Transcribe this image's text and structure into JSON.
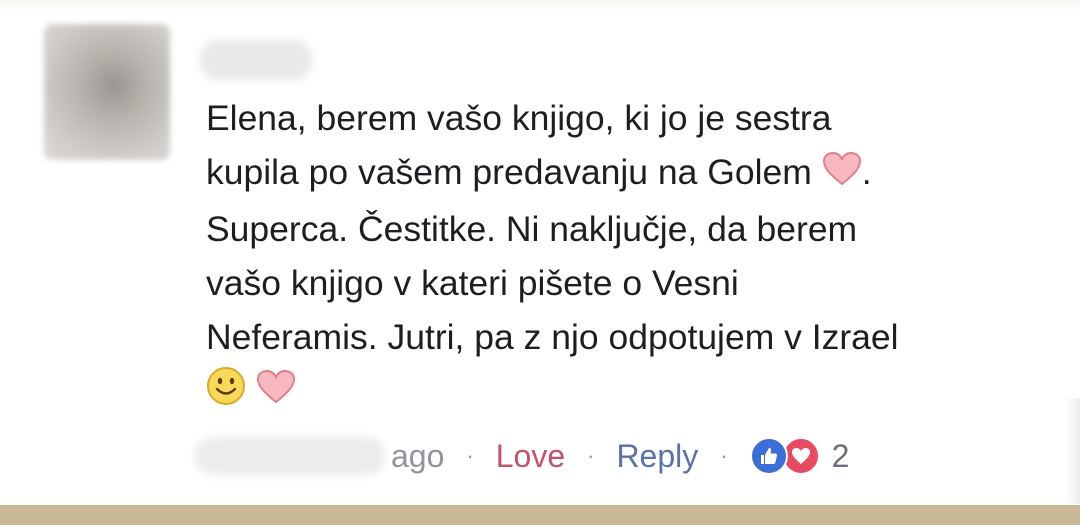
{
  "comment": {
    "lines": [
      "Elena, berem vašo knjigo, ki jo je sestra",
      "kupila po vašem predavanju na Golem",
      ".",
      "Superca. Čestitke. Ni naključje, da berem",
      "vašo knjigo v kateri pišete o Vesni",
      "Neferamis. Jutri, pa z njo odpotujem v Izrael"
    ],
    "emojis": [
      "heart-icon",
      "smile-icon",
      "heart-icon"
    ]
  },
  "meta": {
    "time_suffix": "ago",
    "separator": "·",
    "love_label": "Love",
    "reply_label": "Reply",
    "reaction_count": "2",
    "colors": {
      "love": "#c2546a",
      "reply": "#5a72a8",
      "like_badge": "#3b6fd8",
      "love_badge": "#e84a5f"
    }
  }
}
